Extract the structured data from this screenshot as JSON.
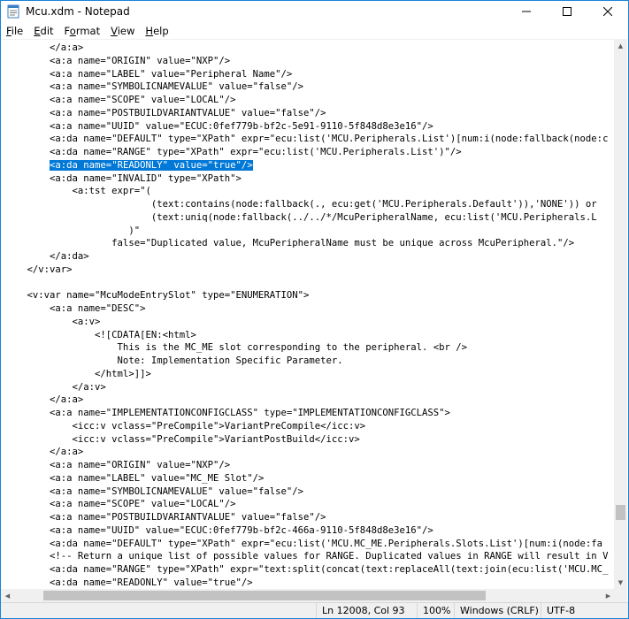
{
  "window": {
    "title": "Mcu.xdm - Notepad",
    "controls": [
      "minimize-icon",
      "maximize-icon",
      "close-icon"
    ]
  },
  "menu": [
    "File",
    "Edit",
    "Format",
    "View",
    "Help"
  ],
  "menu_mnemonics": [
    "F",
    "E",
    "o",
    "V",
    "H"
  ],
  "editor": {
    "selected_line_index": 9,
    "lines": [
      "        </a:a>",
      "        <a:a name=\"ORIGIN\" value=\"NXP\"/>",
      "        <a:a name=\"LABEL\" value=\"Peripheral Name\"/>",
      "        <a:a name=\"SYMBOLICNAMEVALUE\" value=\"false\"/>",
      "        <a:a name=\"SCOPE\" value=\"LOCAL\"/>",
      "        <a:a name=\"POSTBUILDVARIANTVALUE\" value=\"false\"/>",
      "        <a:a name=\"UUID\" value=\"ECUC:0fef779b-bf2c-5e91-9110-5f848d8e3e16\"/>",
      "        <a:da name=\"DEFAULT\" type=\"XPath\" expr=\"ecu:list('MCU.Peripherals.List')[num:i(node:fallback(node:c",
      "        <a:da name=\"RANGE\" type=\"XPath\" expr=\"ecu:list('MCU.Peripherals.List')\"/>",
      "        <a:da name=\"READONLY\" value=\"true\"/>",
      "        <a:da name=\"INVALID\" type=\"XPath\">",
      "            <a:tst expr=\"(",
      "                          (text:contains(node:fallback(., ecu:get('MCU.Peripherals.Default')),'NONE')) or",
      "                          (text:uniq(node:fallback(../../*/McuPeripheralName, ecu:list('MCU.Peripherals.L",
      "                      )\"",
      "                   false=\"Duplicated value, McuPeripheralName must be unique across McuPeripheral.\"/>",
      "        </a:da>",
      "    </v:var>",
      "",
      "    <v:var name=\"McuModeEntrySlot\" type=\"ENUMERATION\">",
      "        <a:a name=\"DESC\">",
      "            <a:v>",
      "                <![CDATA[EN:<html>",
      "                    This is the MC_ME slot corresponding to the peripheral. <br />",
      "                    Note: Implementation Specific Parameter.",
      "                </html>]]>",
      "            </a:v>",
      "        </a:a>",
      "        <a:a name=\"IMPLEMENTATIONCONFIGCLASS\" type=\"IMPLEMENTATIONCONFIGCLASS\">",
      "            <icc:v vclass=\"PreCompile\">VariantPreCompile</icc:v>",
      "            <icc:v vclass=\"PreCompile\">VariantPostBuild</icc:v>",
      "        </a:a>",
      "        <a:a name=\"ORIGIN\" value=\"NXP\"/>",
      "        <a:a name=\"LABEL\" value=\"MC_ME Slot\"/>",
      "        <a:a name=\"SYMBOLICNAMEVALUE\" value=\"false\"/>",
      "        <a:a name=\"SCOPE\" value=\"LOCAL\"/>",
      "        <a:a name=\"POSTBUILDVARIANTVALUE\" value=\"false\"/>",
      "        <a:a name=\"UUID\" value=\"ECUC:0fef779b-bf2c-466a-9110-5f848d8e3e16\"/>",
      "        <a:da name=\"DEFAULT\" type=\"XPath\" expr=\"ecu:list('MCU.MC_ME.Peripherals.Slots.List')[num:i(node:fa",
      "        <!-- Return a unique list of possible values for RANGE. Duplicated values in RANGE will result in V",
      "        <a:da name=\"RANGE\" type=\"XPath\" expr=\"text:split(concat(text:replaceAll(text:join(ecu:list('MCU.MC_",
      "        <a:da name=\"READONLY\" value=\"true\"/>"
    ]
  },
  "statusbar": {
    "position": "Ln 12008, Col 93",
    "zoom": "100%",
    "line_ending": "Windows (CRLF)",
    "encoding": "UTF-8"
  },
  "scroll": {
    "vertical_fraction": 0.89,
    "horizontal_fraction": 0.2
  }
}
